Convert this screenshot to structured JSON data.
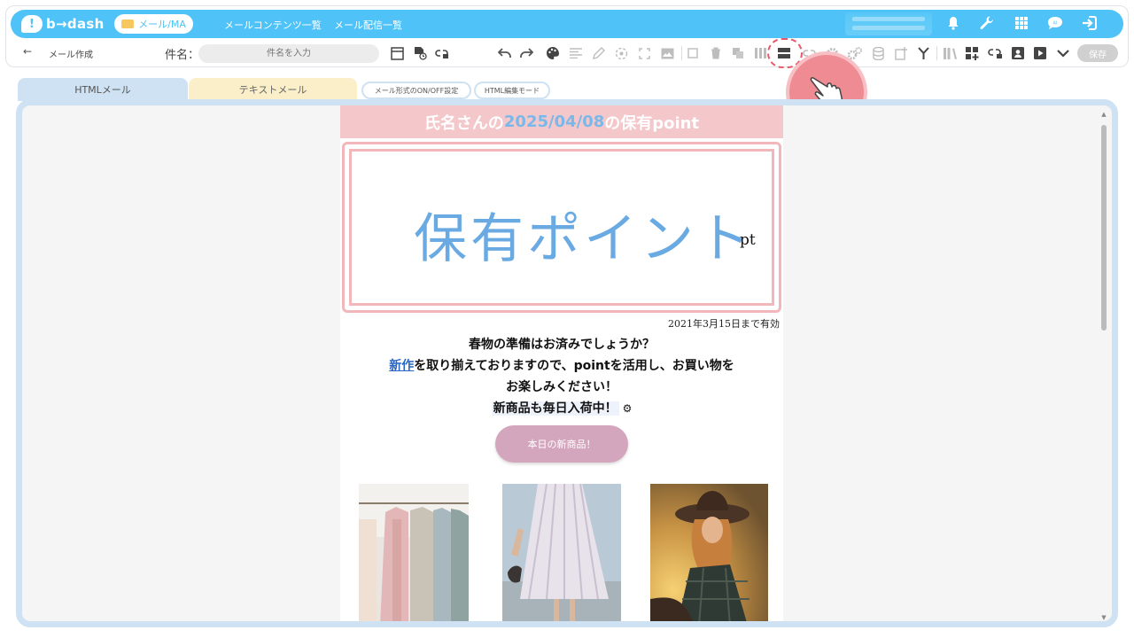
{
  "app": {
    "logo_text": "b→dash",
    "module_pill": "メール/MA",
    "nav": [
      "メールコンテンツ一覧",
      "メール配信一覧"
    ],
    "accent_color": "#4fc3f7"
  },
  "toolbar": {
    "title": "メール作成",
    "subject_label": "件名：",
    "subject_placeholder": "件名を入力",
    "save_label": "保存"
  },
  "tabs": {
    "html": "HTMLメール",
    "text": "テキストメール",
    "onoff": "メール形式のON/OFF設定",
    "html_edit": "HTML編集モード"
  },
  "mail": {
    "header_pre": "氏名さんの",
    "header_date": "2025/04/08",
    "header_post": "の保有point",
    "hero_text": "保有ポイント",
    "hero_unit": "pt",
    "valid_until": "2021年3月15日まで有効",
    "line1": "春物の準備はお済みでしょうか？",
    "line2_link": "新作",
    "line2_rest": "を取り揃えておりますので、pointを活用し、お買い物を",
    "line3": "お楽しみください！",
    "line4": "新商品も毎日入荷中！",
    "cta_label": "本日の新商品！",
    "colors": {
      "header_bg": "#f4c8cb",
      "hero_text": "#6aaae3",
      "cta_bg": "#d4a6be"
    }
  },
  "icons": [
    "bell-icon",
    "wrench-icon",
    "grid-icon",
    "chat-icon",
    "logout-icon"
  ]
}
